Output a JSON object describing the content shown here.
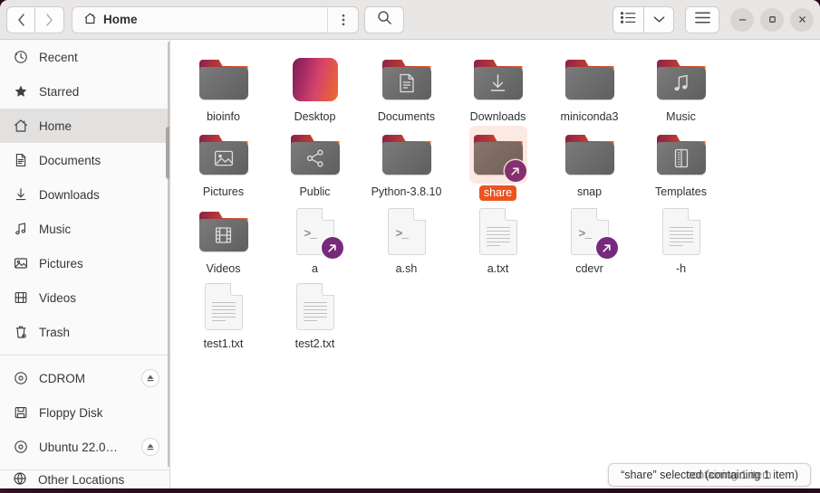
{
  "window": {
    "title": "Home"
  },
  "headerbar": {
    "back_label": "‹",
    "forward_label": "›",
    "path_label": "Home",
    "path_menu_label": "⋮",
    "search_label": "search-icon",
    "view_list_label": "list-view-icon",
    "view_dropdown_label": "chevron-down-icon",
    "hamburger_label": "menu-icon",
    "minimize_label": "–",
    "maximize_label": "□",
    "close_label": "×"
  },
  "sidebar": {
    "items": [
      {
        "label": "Recent",
        "icon": "clock-icon",
        "active": false,
        "eject": false
      },
      {
        "label": "Starred",
        "icon": "star-icon",
        "active": false,
        "eject": false
      },
      {
        "label": "Home",
        "icon": "home-icon",
        "active": true,
        "eject": false
      },
      {
        "label": "Documents",
        "icon": "doc-icon",
        "active": false,
        "eject": false
      },
      {
        "label": "Downloads",
        "icon": "download-icon",
        "active": false,
        "eject": false
      },
      {
        "label": "Music",
        "icon": "music-icon",
        "active": false,
        "eject": false
      },
      {
        "label": "Pictures",
        "icon": "image-icon",
        "active": false,
        "eject": false
      },
      {
        "label": "Videos",
        "icon": "video-icon",
        "active": false,
        "eject": false
      },
      {
        "label": "Trash",
        "icon": "trash-icon",
        "active": false,
        "eject": false
      }
    ],
    "devices": [
      {
        "label": "CDROM",
        "icon": "disc-icon",
        "eject": true
      },
      {
        "label": "Floppy Disk",
        "icon": "floppy-icon",
        "eject": false
      },
      {
        "label": "Ubuntu 22.0…",
        "icon": "disc-icon",
        "eject": true
      }
    ],
    "partial_item": {
      "label": "Other Locations",
      "icon": "network-icon"
    }
  },
  "files": {
    "items": [
      {
        "name": "bioinfo",
        "type": "folder",
        "emblem": "none",
        "selected": false,
        "glyph": "none"
      },
      {
        "name": "Desktop",
        "type": "desktop",
        "emblem": "none",
        "selected": false,
        "glyph": "none"
      },
      {
        "name": "Documents",
        "type": "folder",
        "emblem": "none",
        "selected": false,
        "glyph": "document"
      },
      {
        "name": "Downloads",
        "type": "folder",
        "emblem": "none",
        "selected": false,
        "glyph": "download"
      },
      {
        "name": "miniconda3",
        "type": "folder",
        "emblem": "none",
        "selected": false,
        "glyph": "none"
      },
      {
        "name": "Music",
        "type": "folder",
        "emblem": "none",
        "selected": false,
        "glyph": "music"
      },
      {
        "name": "Pictures",
        "type": "folder",
        "emblem": "none",
        "selected": false,
        "glyph": "image"
      },
      {
        "name": "Public",
        "type": "folder",
        "emblem": "none",
        "selected": false,
        "glyph": "share"
      },
      {
        "name": "Python-3.8.10",
        "type": "folder",
        "emblem": "none",
        "selected": false,
        "glyph": "none"
      },
      {
        "name": "share",
        "type": "folder",
        "emblem": "symlink",
        "selected": true,
        "glyph": "none"
      },
      {
        "name": "snap",
        "type": "folder",
        "emblem": "none",
        "selected": false,
        "glyph": "none"
      },
      {
        "name": "Templates",
        "type": "folder",
        "emblem": "none",
        "selected": false,
        "glyph": "template"
      },
      {
        "name": "Videos",
        "type": "folder",
        "emblem": "none",
        "selected": false,
        "glyph": "video"
      },
      {
        "name": "a",
        "type": "script",
        "emblem": "symlink",
        "selected": false,
        "glyph": "none"
      },
      {
        "name": "a.sh",
        "type": "script",
        "emblem": "none",
        "selected": false,
        "glyph": "none"
      },
      {
        "name": "a.txt",
        "type": "text",
        "emblem": "none",
        "selected": false,
        "glyph": "none"
      },
      {
        "name": "cdevr",
        "type": "script",
        "emblem": "symlink",
        "selected": false,
        "glyph": "none"
      },
      {
        "name": "-h",
        "type": "text",
        "emblem": "none",
        "selected": false,
        "glyph": "none"
      },
      {
        "name": "test1.txt",
        "type": "text",
        "emblem": "none",
        "selected": false,
        "glyph": "none"
      },
      {
        "name": "test2.txt",
        "type": "text",
        "emblem": "none",
        "selected": false,
        "glyph": "none"
      }
    ]
  },
  "statusbar": {
    "text": "“share” selected (containing 1 item)",
    "ghost_text": "containing 1 item"
  },
  "colors": {
    "accent": "#e95420",
    "symlink": "#762a7c",
    "header_bg": "#e9e7e6",
    "sidebar_bg": "#fafafa",
    "desktop_bg": "#2b0a1e"
  }
}
